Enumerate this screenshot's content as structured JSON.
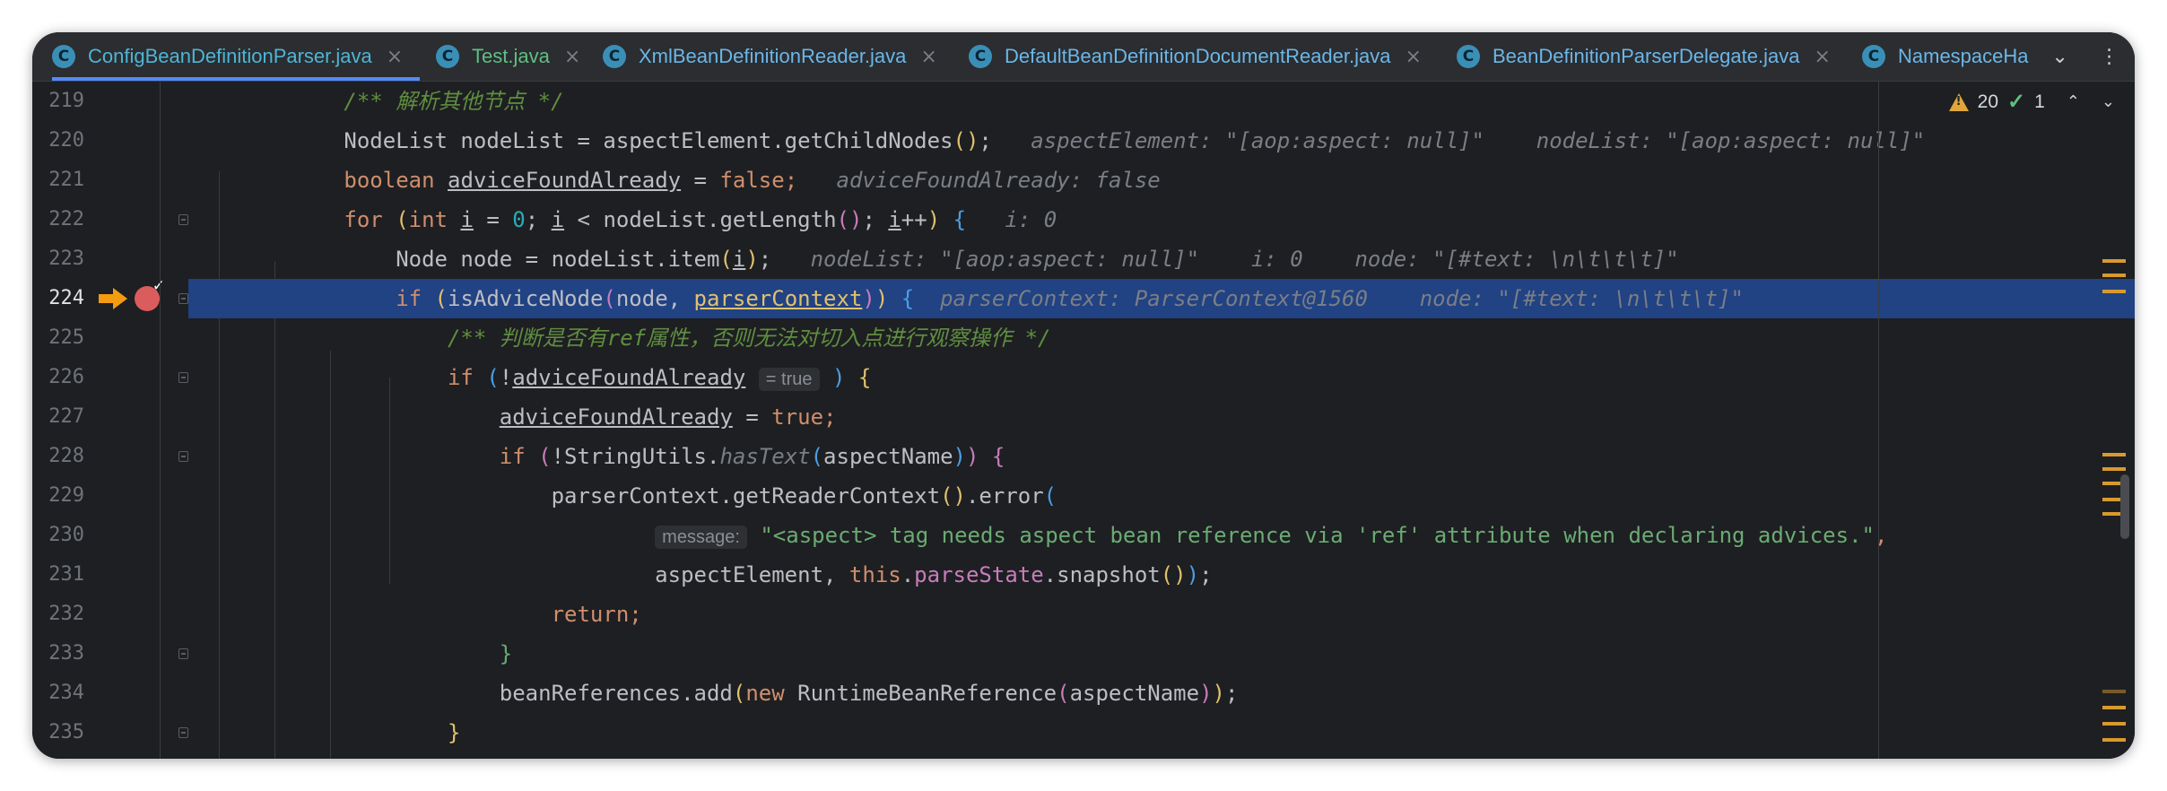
{
  "tabs": [
    {
      "label": "ConfigBeanDefinitionParser.java",
      "active": true,
      "icon": "class-icon"
    },
    {
      "label": "Test.java",
      "active": false,
      "icon": "class-run-icon"
    },
    {
      "label": "XmlBeanDefinitionReader.java",
      "active": false,
      "icon": "class-icon"
    },
    {
      "label": "DefaultBeanDefinitionDocumentReader.java",
      "active": false,
      "icon": "class-icon"
    },
    {
      "label": "BeanDefinitionParserDelegate.java",
      "active": false,
      "icon": "class-icon"
    },
    {
      "label": "NamespaceHa",
      "active": false,
      "icon": "class-icon"
    }
  ],
  "tab_close_glyph": "×",
  "tab_icon_letter": "C",
  "inspection": {
    "warnings": "20",
    "checks": "1"
  },
  "breakpoint_line": 224,
  "code": {
    "lines": [
      {
        "n": "219",
        "segments": [
          {
            "t": "            "
          },
          {
            "t": "/** ",
            "c": "t-cmt"
          },
          {
            "t": "解析其他节点",
            "c": "t-cmt"
          },
          {
            "t": " */",
            "c": "t-cmt"
          }
        ]
      },
      {
        "n": "220",
        "segments": [
          {
            "t": "            NodeList nodeList = aspectElement.getChildNodes"
          },
          {
            "t": "(",
            "c": "t-p1"
          },
          {
            "t": ")",
            "c": "t-p1"
          },
          {
            "t": ";"
          },
          {
            "t": "   aspectElement: \"[aop:aspect: null]\"    nodeList: \"[aop:aspect: null]\"",
            "c": "hint"
          }
        ]
      },
      {
        "n": "221",
        "segments": [
          {
            "t": "            "
          },
          {
            "t": "boolean",
            "c": "t-kw"
          },
          {
            "t": " "
          },
          {
            "t": "adviceFoundAlready",
            "c": "under"
          },
          {
            "t": " = "
          },
          {
            "t": "false",
            "c": "t-kw"
          },
          {
            "t": ";",
            "c": "t-kw"
          },
          {
            "t": "   adviceFoundAlready: false",
            "c": "hint"
          }
        ]
      },
      {
        "n": "222",
        "segments": [
          {
            "t": "            "
          },
          {
            "t": "for",
            "c": "t-kw"
          },
          {
            "t": " "
          },
          {
            "t": "(",
            "c": "t-p1"
          },
          {
            "t": "int",
            "c": "t-kw"
          },
          {
            "t": " "
          },
          {
            "t": "i",
            "c": "under"
          },
          {
            "t": " = "
          },
          {
            "t": "0",
            "c": "t-num"
          },
          {
            "t": "; "
          },
          {
            "t": "i",
            "c": "under"
          },
          {
            "t": " < nodeList.getLength"
          },
          {
            "t": "(",
            "c": "t-p2"
          },
          {
            "t": ")",
            "c": "t-p2"
          },
          {
            "t": "; "
          },
          {
            "t": "i",
            "c": "under"
          },
          {
            "t": "++"
          },
          {
            "t": ")",
            "c": "t-p1"
          },
          {
            "t": " "
          },
          {
            "t": "{",
            "c": "t-p3"
          },
          {
            "t": "   i: 0",
            "c": "hint"
          }
        ]
      },
      {
        "n": "223",
        "segments": [
          {
            "t": "                Node node = nodeList.item"
          },
          {
            "t": "(",
            "c": "t-p1"
          },
          {
            "t": "i",
            "c": "under"
          },
          {
            "t": ")",
            "c": "t-p1"
          },
          {
            "t": ";"
          },
          {
            "t": "   nodeList: \"[aop:aspect: null]\"    i: 0    node: \"[#text: \\n\\t\\t\\t]\"",
            "c": "hint"
          }
        ]
      },
      {
        "n": "224",
        "segments": [
          {
            "t": "                "
          },
          {
            "t": "if",
            "c": "t-kw"
          },
          {
            "t": " "
          },
          {
            "t": "(",
            "c": "t-p1"
          },
          {
            "t": "isAdviceNode"
          },
          {
            "t": "(",
            "c": "t-p2"
          },
          {
            "t": "node, "
          },
          {
            "t": "parserContext",
            "c": "under t-p1"
          },
          {
            "t": ")",
            "c": "t-p2"
          },
          {
            "t": ")",
            "c": "t-p1"
          },
          {
            "t": " "
          },
          {
            "t": "{",
            "c": "t-p3"
          },
          {
            "t": "  parserContext: ParserContext@1560    node: \"[#text: \\n\\t\\t\\t]\"",
            "c": "hint"
          }
        ]
      },
      {
        "n": "225",
        "segments": [
          {
            "t": "                    "
          },
          {
            "t": "/** ",
            "c": "t-cmt"
          },
          {
            "t": "判断是否有",
            "c": "t-cmt"
          },
          {
            "t": "ref",
            "c": "t-cmt"
          },
          {
            "t": "属性，否则无法对切入点进行观察操作",
            "c": "t-cmt"
          },
          {
            "t": " */",
            "c": "t-cmt"
          }
        ]
      },
      {
        "n": "226",
        "segments": [
          {
            "t": "                    "
          },
          {
            "t": "if",
            "c": "t-kw"
          },
          {
            "t": " "
          },
          {
            "t": "(",
            "c": "t-p3"
          },
          {
            "t": "!"
          },
          {
            "t": "adviceFoundAlready",
            "c": "under"
          },
          {
            "t": " "
          },
          {
            "t": "= true",
            "c": "inlay"
          },
          {
            "t": " "
          },
          {
            "t": ")",
            "c": "t-p3"
          },
          {
            "t": " "
          },
          {
            "t": "{",
            "c": "t-p1"
          }
        ]
      },
      {
        "n": "227",
        "segments": [
          {
            "t": "                        "
          },
          {
            "t": "adviceFoundAlready",
            "c": "under"
          },
          {
            "t": " = "
          },
          {
            "t": "true",
            "c": "t-kw"
          },
          {
            "t": ";",
            "c": "t-kw"
          }
        ]
      },
      {
        "n": "228",
        "segments": [
          {
            "t": "                        "
          },
          {
            "t": "if",
            "c": "t-kw"
          },
          {
            "t": " "
          },
          {
            "t": "(",
            "c": "t-p2"
          },
          {
            "t": "!StringUtils."
          },
          {
            "t": "hasText",
            "c": "hint"
          },
          {
            "t": "(",
            "c": "t-p3"
          },
          {
            "t": "aspectName"
          },
          {
            "t": ")",
            "c": "t-p3"
          },
          {
            "t": ")",
            "c": "t-p2"
          },
          {
            "t": " "
          },
          {
            "t": "{",
            "c": "t-p2"
          }
        ]
      },
      {
        "n": "229",
        "segments": [
          {
            "t": "                            parserContext.getReaderContext"
          },
          {
            "t": "(",
            "c": "t-p1"
          },
          {
            "t": ")",
            "c": "t-p1"
          },
          {
            "t": ".error"
          },
          {
            "t": "(",
            "c": "t-p3"
          }
        ]
      },
      {
        "n": "230",
        "segments": [
          {
            "t": "                                    "
          },
          {
            "t": "message:",
            "c": "inlay"
          },
          {
            "t": " "
          },
          {
            "t": "\"<aspect> tag needs aspect bean reference via 'ref' attribute when declaring advices.\"",
            "c": "t-str"
          },
          {
            "t": ",",
            "c": "t-kw"
          }
        ]
      },
      {
        "n": "231",
        "segments": [
          {
            "t": "                                    aspectElement, "
          },
          {
            "t": "this",
            "c": "t-kw"
          },
          {
            "t": "."
          },
          {
            "t": "parseState",
            "c": "t-fld"
          },
          {
            "t": ".snapshot"
          },
          {
            "t": "(",
            "c": "t-p1"
          },
          {
            "t": ")",
            "c": "t-p1"
          },
          {
            "t": ")",
            "c": "t-p3"
          },
          {
            "t": ";"
          }
        ]
      },
      {
        "n": "232",
        "segments": [
          {
            "t": "                            "
          },
          {
            "t": "return",
            "c": "t-kw"
          },
          {
            "t": ";",
            "c": "t-kw"
          }
        ]
      },
      {
        "n": "233",
        "segments": [
          {
            "t": "                        "
          },
          {
            "t": "}",
            "c": "t-str"
          }
        ]
      },
      {
        "n": "234",
        "segments": [
          {
            "t": "                        beanReferences.add"
          },
          {
            "t": "(",
            "c": "t-p1"
          },
          {
            "t": "new",
            "c": "t-kw"
          },
          {
            "t": " RuntimeBeanReference"
          },
          {
            "t": "(",
            "c": "t-p2"
          },
          {
            "t": "aspectName"
          },
          {
            "t": ")",
            "c": "t-p2"
          },
          {
            "t": ")",
            "c": "t-p1"
          },
          {
            "t": ";"
          }
        ]
      },
      {
        "n": "235",
        "segments": [
          {
            "t": "                    "
          },
          {
            "t": "}",
            "c": "t-p1"
          }
        ]
      }
    ]
  },
  "colors": {
    "accent": "#548af7",
    "highlight": "#214283",
    "breakpoint": "#db5c5c",
    "exec_arrow": "#f39c12"
  }
}
